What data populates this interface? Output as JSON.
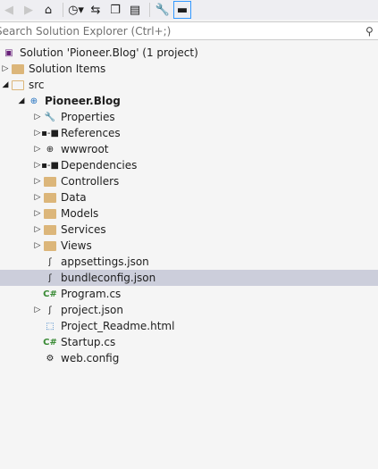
{
  "toolbar": {
    "buttons": [
      {
        "name": "back-icon",
        "glyph": "◀",
        "disabled": true
      },
      {
        "name": "forward-icon",
        "glyph": "▶",
        "disabled": true
      },
      {
        "name": "home-icon",
        "glyph": "⌂",
        "disabled": false
      },
      {
        "name": "pending-changes-filter-icon",
        "glyph": "◷▾",
        "disabled": false
      },
      {
        "name": "sync-with-active-document-icon",
        "glyph": "⇆",
        "disabled": false
      },
      {
        "name": "collapse-all-icon",
        "glyph": "❐",
        "disabled": false
      },
      {
        "name": "show-all-files-icon",
        "glyph": "▤",
        "disabled": false
      },
      {
        "name": "properties-icon",
        "glyph": "🔧",
        "disabled": false
      },
      {
        "name": "preview-selected-items-icon",
        "glyph": "▬",
        "disabled": false
      }
    ]
  },
  "search": {
    "placeholder": "Search Solution Explorer (Ctrl+;)",
    "icon": "search-icon"
  },
  "tree": [
    {
      "label": "Solution 'Pioneer.Blog' (1 project)",
      "indent": 0,
      "arrow": "",
      "icon": "solution"
    },
    {
      "label": "Solution Items",
      "indent": 0,
      "arrow": "▷",
      "icon": "folder"
    },
    {
      "label": "src",
      "indent": 0,
      "arrow": "◢",
      "icon": "folder-open"
    },
    {
      "label": "Pioneer.Blog",
      "indent": 1,
      "arrow": "◢",
      "icon": "web-project",
      "bold": true
    },
    {
      "label": "Properties",
      "indent": 2,
      "arrow": "▷",
      "icon": "wrench"
    },
    {
      "label": "References",
      "indent": 2,
      "arrow": "▷",
      "icon": "references"
    },
    {
      "label": "wwwroot",
      "indent": 2,
      "arrow": "▷",
      "icon": "globe-folder"
    },
    {
      "label": "Dependencies",
      "indent": 2,
      "arrow": "▷",
      "icon": "references"
    },
    {
      "label": "Controllers",
      "indent": 2,
      "arrow": "▷",
      "icon": "folder"
    },
    {
      "label": "Data",
      "indent": 2,
      "arrow": "▷",
      "icon": "folder"
    },
    {
      "label": "Models",
      "indent": 2,
      "arrow": "▷",
      "icon": "folder"
    },
    {
      "label": "Services",
      "indent": 2,
      "arrow": "▷",
      "icon": "folder"
    },
    {
      "label": "Views",
      "indent": 2,
      "arrow": "▷",
      "icon": "folder"
    },
    {
      "label": "appsettings.json",
      "indent": 2,
      "arrow": "",
      "icon": "json"
    },
    {
      "label": "bundleconfig.json",
      "indent": 2,
      "arrow": "",
      "icon": "json",
      "selected": true
    },
    {
      "label": "Program.cs",
      "indent": 2,
      "arrow": "",
      "icon": "csharp"
    },
    {
      "label": "project.json",
      "indent": 2,
      "arrow": "▷",
      "icon": "json"
    },
    {
      "label": "Project_Readme.html",
      "indent": 2,
      "arrow": "",
      "icon": "html"
    },
    {
      "label": "Startup.cs",
      "indent": 2,
      "arrow": "",
      "icon": "csharp"
    },
    {
      "label": "web.config",
      "indent": 2,
      "arrow": "",
      "icon": "config"
    }
  ],
  "colors": {
    "selection": "#cccedb",
    "folder": "#dcb67a",
    "accent": "#3399ff"
  }
}
